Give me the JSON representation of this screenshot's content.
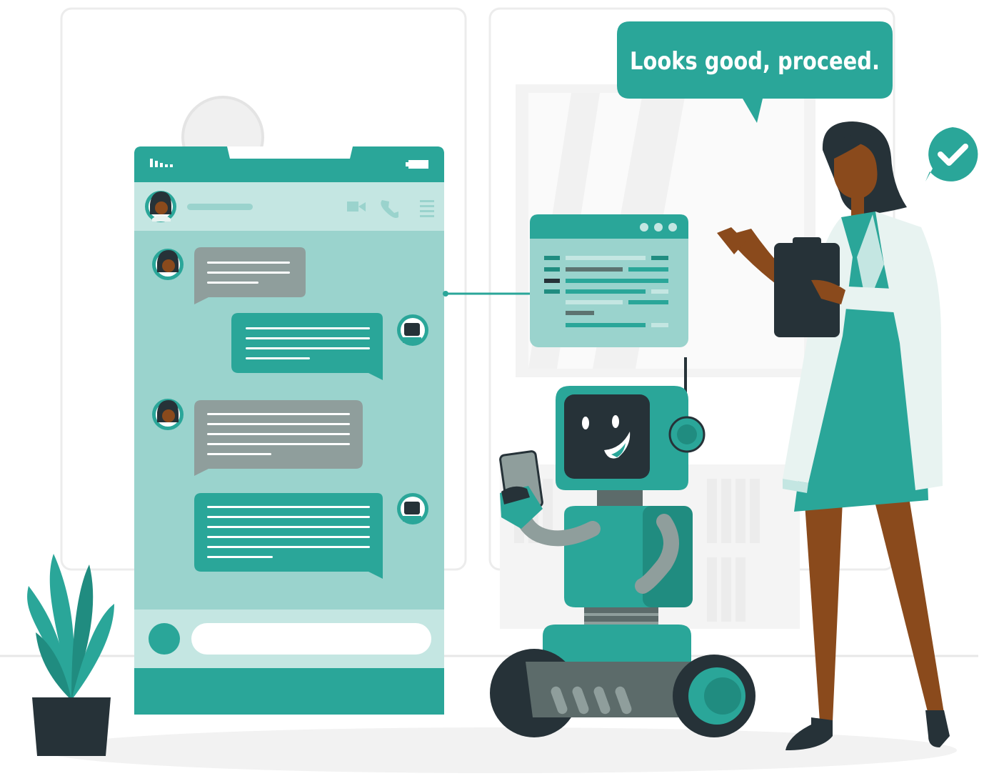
{
  "speech_bubble": {
    "text": "Looks good, proceed."
  },
  "colors": {
    "teal": "#2aa699",
    "teal_dark": "#208c80",
    "teal_light": "#9ad3cd",
    "teal_pale": "#c4e6e2",
    "gray_bubble": "#8f9e9c",
    "dark": "#263238",
    "skin": "#8a4a1c",
    "coat": "#e8f3f1",
    "background_panel": "#f5f5f5"
  },
  "icons": {
    "signal": "signal-bars-icon",
    "battery": "battery-icon",
    "video": "video-camera-icon",
    "phone": "phone-icon",
    "menu": "menu-icon",
    "check": "check-badge-icon"
  }
}
